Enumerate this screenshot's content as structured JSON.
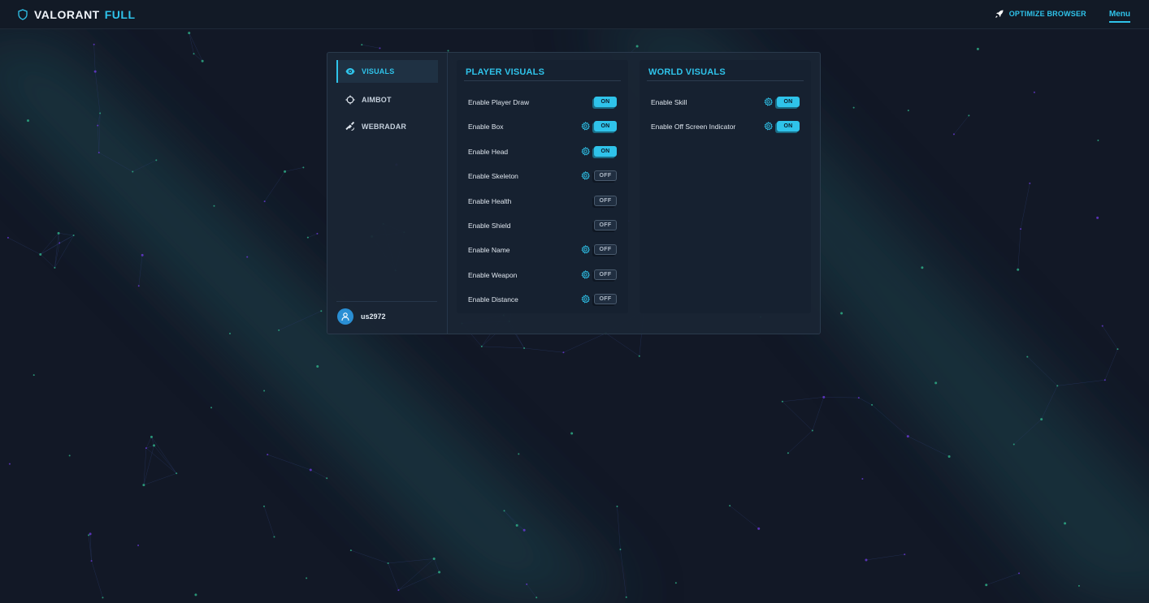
{
  "brand": {
    "title": "VALORANT",
    "accent": "FULL"
  },
  "topnav": {
    "optimize_label": "OPTIMIZE BROWSER",
    "menu_label": "Menu"
  },
  "sidebar": {
    "items": [
      {
        "label": "VISUALS",
        "icon": "eye-icon",
        "active": true
      },
      {
        "label": "AIMBOT",
        "icon": "crosshair-icon",
        "active": false
      },
      {
        "label": "WEBRADAR",
        "icon": "satellite-icon",
        "active": false
      }
    ],
    "user": {
      "name": "us2972"
    }
  },
  "player_visuals": {
    "title": "PLAYER VISUALS",
    "rows": [
      {
        "label": "Enable Player Draw",
        "settings": false,
        "state": "ON"
      },
      {
        "label": "Enable Box",
        "settings": true,
        "state": "ON"
      },
      {
        "label": "Enable Head",
        "settings": true,
        "state": "ON"
      },
      {
        "label": "Enable Skeleton",
        "settings": true,
        "state": "OFF"
      },
      {
        "label": "Enable Health",
        "settings": false,
        "state": "OFF"
      },
      {
        "label": "Enable Shield",
        "settings": false,
        "state": "OFF"
      },
      {
        "label": "Enable Name",
        "settings": true,
        "state": "OFF"
      },
      {
        "label": "Enable Weapon",
        "settings": true,
        "state": "OFF"
      },
      {
        "label": "Enable Distance",
        "settings": true,
        "state": "OFF"
      }
    ]
  },
  "world_visuals": {
    "title": "WORLD VISUALS",
    "rows": [
      {
        "label": "Enable Skill",
        "settings": true,
        "state": "ON"
      },
      {
        "label": "Enable Off Screen Indicator",
        "settings": true,
        "state": "ON"
      }
    ]
  },
  "colors": {
    "accent": "#2fc3ea",
    "background": "#121826",
    "panel": "#1a2534"
  }
}
